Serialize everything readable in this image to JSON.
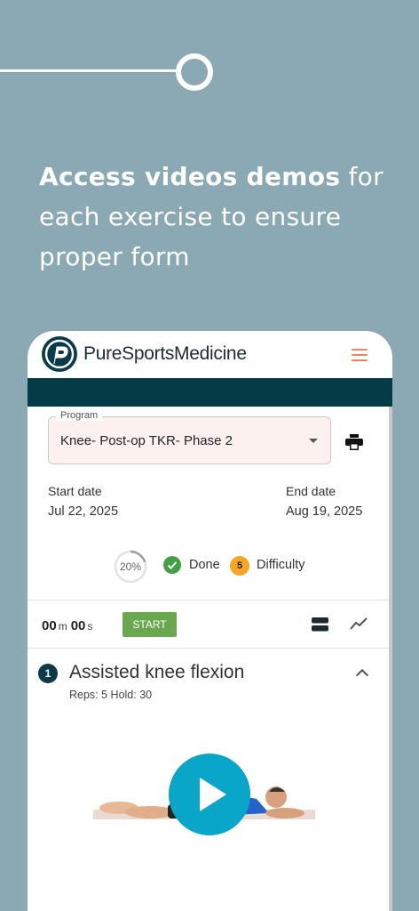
{
  "marketing": {
    "headline_bold": "Access videos demos",
    "headline_rest": " for each exercise to ensure proper form"
  },
  "app": {
    "brand": "PureSportsMedicine",
    "program_label": "Program",
    "program_value": "Knee- Post-op TKR- Phase 2",
    "start_date_label": "Start date",
    "start_date": "Jul 22, 2025",
    "end_date_label": "End date",
    "end_date": "Aug 19, 2025",
    "progress_text": "20%",
    "progress_fraction": 0.2,
    "done_label": "Done",
    "difficulty_value": "5",
    "difficulty_label": "Difficulty",
    "timer_minutes": "00",
    "timer_m_unit": "m",
    "timer_seconds": "00",
    "timer_s_unit": "s",
    "start_label": "START"
  },
  "exercise": {
    "number": "1",
    "title": "Assisted knee flexion",
    "meta": "Reps: 5 Hold: 30"
  },
  "colors": {
    "background": "#8aa9b3",
    "header_bar": "#033b47",
    "accent_orange": "#f0845a",
    "start_green": "#6aa84f",
    "play_blue": "#0aa6c8",
    "difficulty_orange": "#f5a623"
  },
  "icons": [
    "menu-icon",
    "print-icon",
    "check-circle-icon",
    "list-view-icon",
    "trend-icon",
    "chevron-up-icon",
    "play-icon"
  ]
}
